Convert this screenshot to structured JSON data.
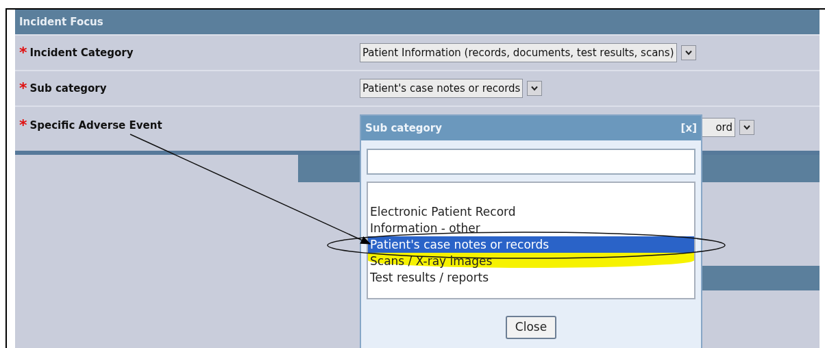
{
  "section": {
    "title": "Incident Focus"
  },
  "fields": [
    {
      "marker": "*",
      "label": "Incident Category",
      "value": "Patient Information (records, documents, test results, scans)"
    },
    {
      "marker": "*",
      "label": "Sub category",
      "value": "Patient's case notes or records"
    },
    {
      "marker": "*",
      "label": "Specific Adverse Event",
      "value": "ord"
    }
  ],
  "popup": {
    "title": "Sub category",
    "close": "[x]",
    "options": [
      {
        "label": "Electronic Patient Record",
        "selected": false
      },
      {
        "label": "Information - other",
        "selected": false
      },
      {
        "label": "Patient's case notes or records",
        "selected": true
      },
      {
        "label": "Scans / X-ray images",
        "selected": false
      },
      {
        "label": "Test results / reports",
        "selected": false
      }
    ],
    "button": "Close"
  }
}
